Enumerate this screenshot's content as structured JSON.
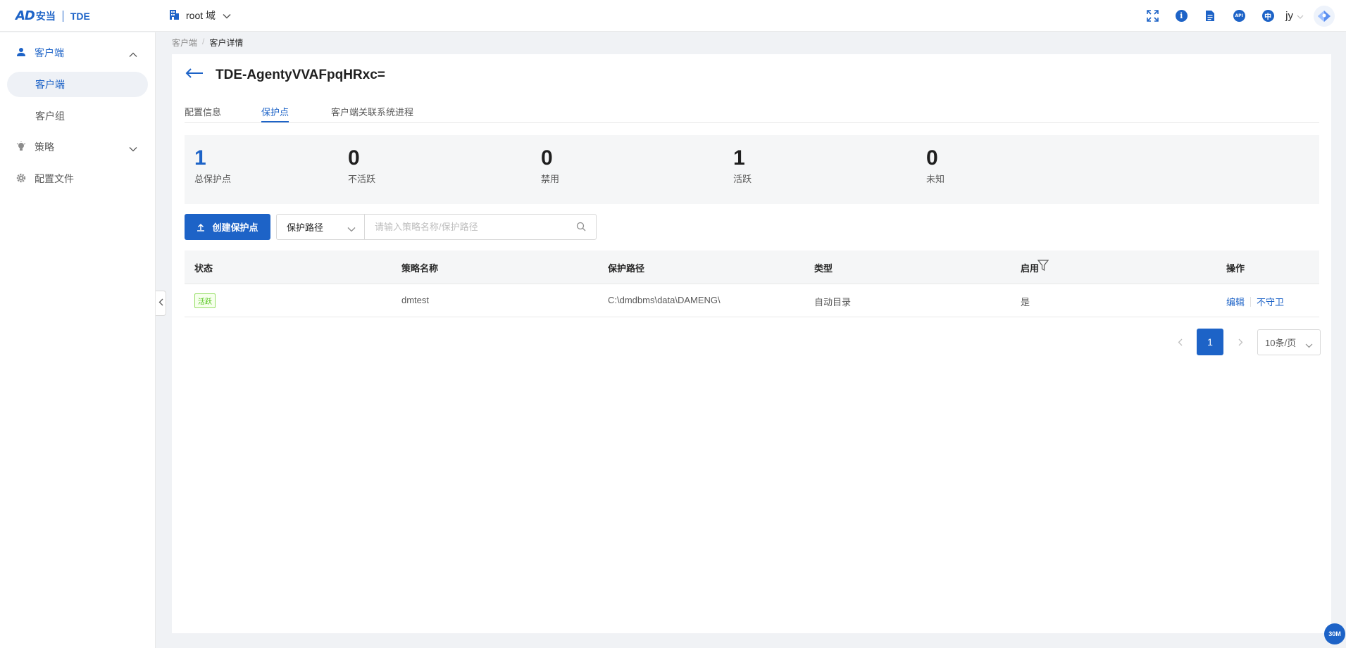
{
  "app": {
    "logo_mark": "AD",
    "logo_cn": "安当",
    "logo_product": "TDE"
  },
  "header": {
    "domain_label": "root 域",
    "user_name": "jy",
    "icons": [
      "fullscreen-icon",
      "info-icon",
      "document-icon",
      "api-icon",
      "language-icon"
    ],
    "api_text": "API",
    "lang_text": "中"
  },
  "sidebar": {
    "items": [
      {
        "label": "客户端",
        "icon": "user-icon",
        "expanded": true
      },
      {
        "label": "客户端",
        "active": true
      },
      {
        "label": "客户组"
      },
      {
        "label": "策略",
        "icon": "bulb-icon",
        "expanded": false
      },
      {
        "label": "配置文件",
        "icon": "gear-icon"
      }
    ]
  },
  "breadcrumb": {
    "items": [
      "客户端",
      "客户详情"
    ],
    "separator": "/"
  },
  "page": {
    "title": "TDE-AgentyVVAFpqHRxc=",
    "tabs": [
      {
        "label": "配置信息",
        "active": false
      },
      {
        "label": "保护点",
        "active": true
      },
      {
        "label": "客户端关联系统进程",
        "active": false
      }
    ]
  },
  "stats": [
    {
      "value": "1",
      "label": "总保护点"
    },
    {
      "value": "0",
      "label": "不活跃"
    },
    {
      "value": "0",
      "label": "禁用"
    },
    {
      "value": "1",
      "label": "活跃"
    },
    {
      "value": "0",
      "label": "未知"
    }
  ],
  "toolbar": {
    "create_label": "创建保护点",
    "select_value": "保护路径",
    "search_placeholder": "请输入策略名称/保护路径"
  },
  "table": {
    "columns": [
      "状态",
      "策略名称",
      "保护路径",
      "类型",
      "启用",
      "操作"
    ],
    "rows": [
      {
        "status": "活跃",
        "policy": "dmtest",
        "path": "C:\\dmdbms\\data\\DAMENG\\",
        "type": "自动目录",
        "enabled": "是",
        "actions": [
          "编辑",
          "不守卫"
        ]
      }
    ]
  },
  "pagination": {
    "current": "1",
    "page_size": "10条/页"
  },
  "memory_badge": "30M",
  "colors": {
    "accent": "#1d63c7",
    "active_badge": "#52c41a"
  }
}
